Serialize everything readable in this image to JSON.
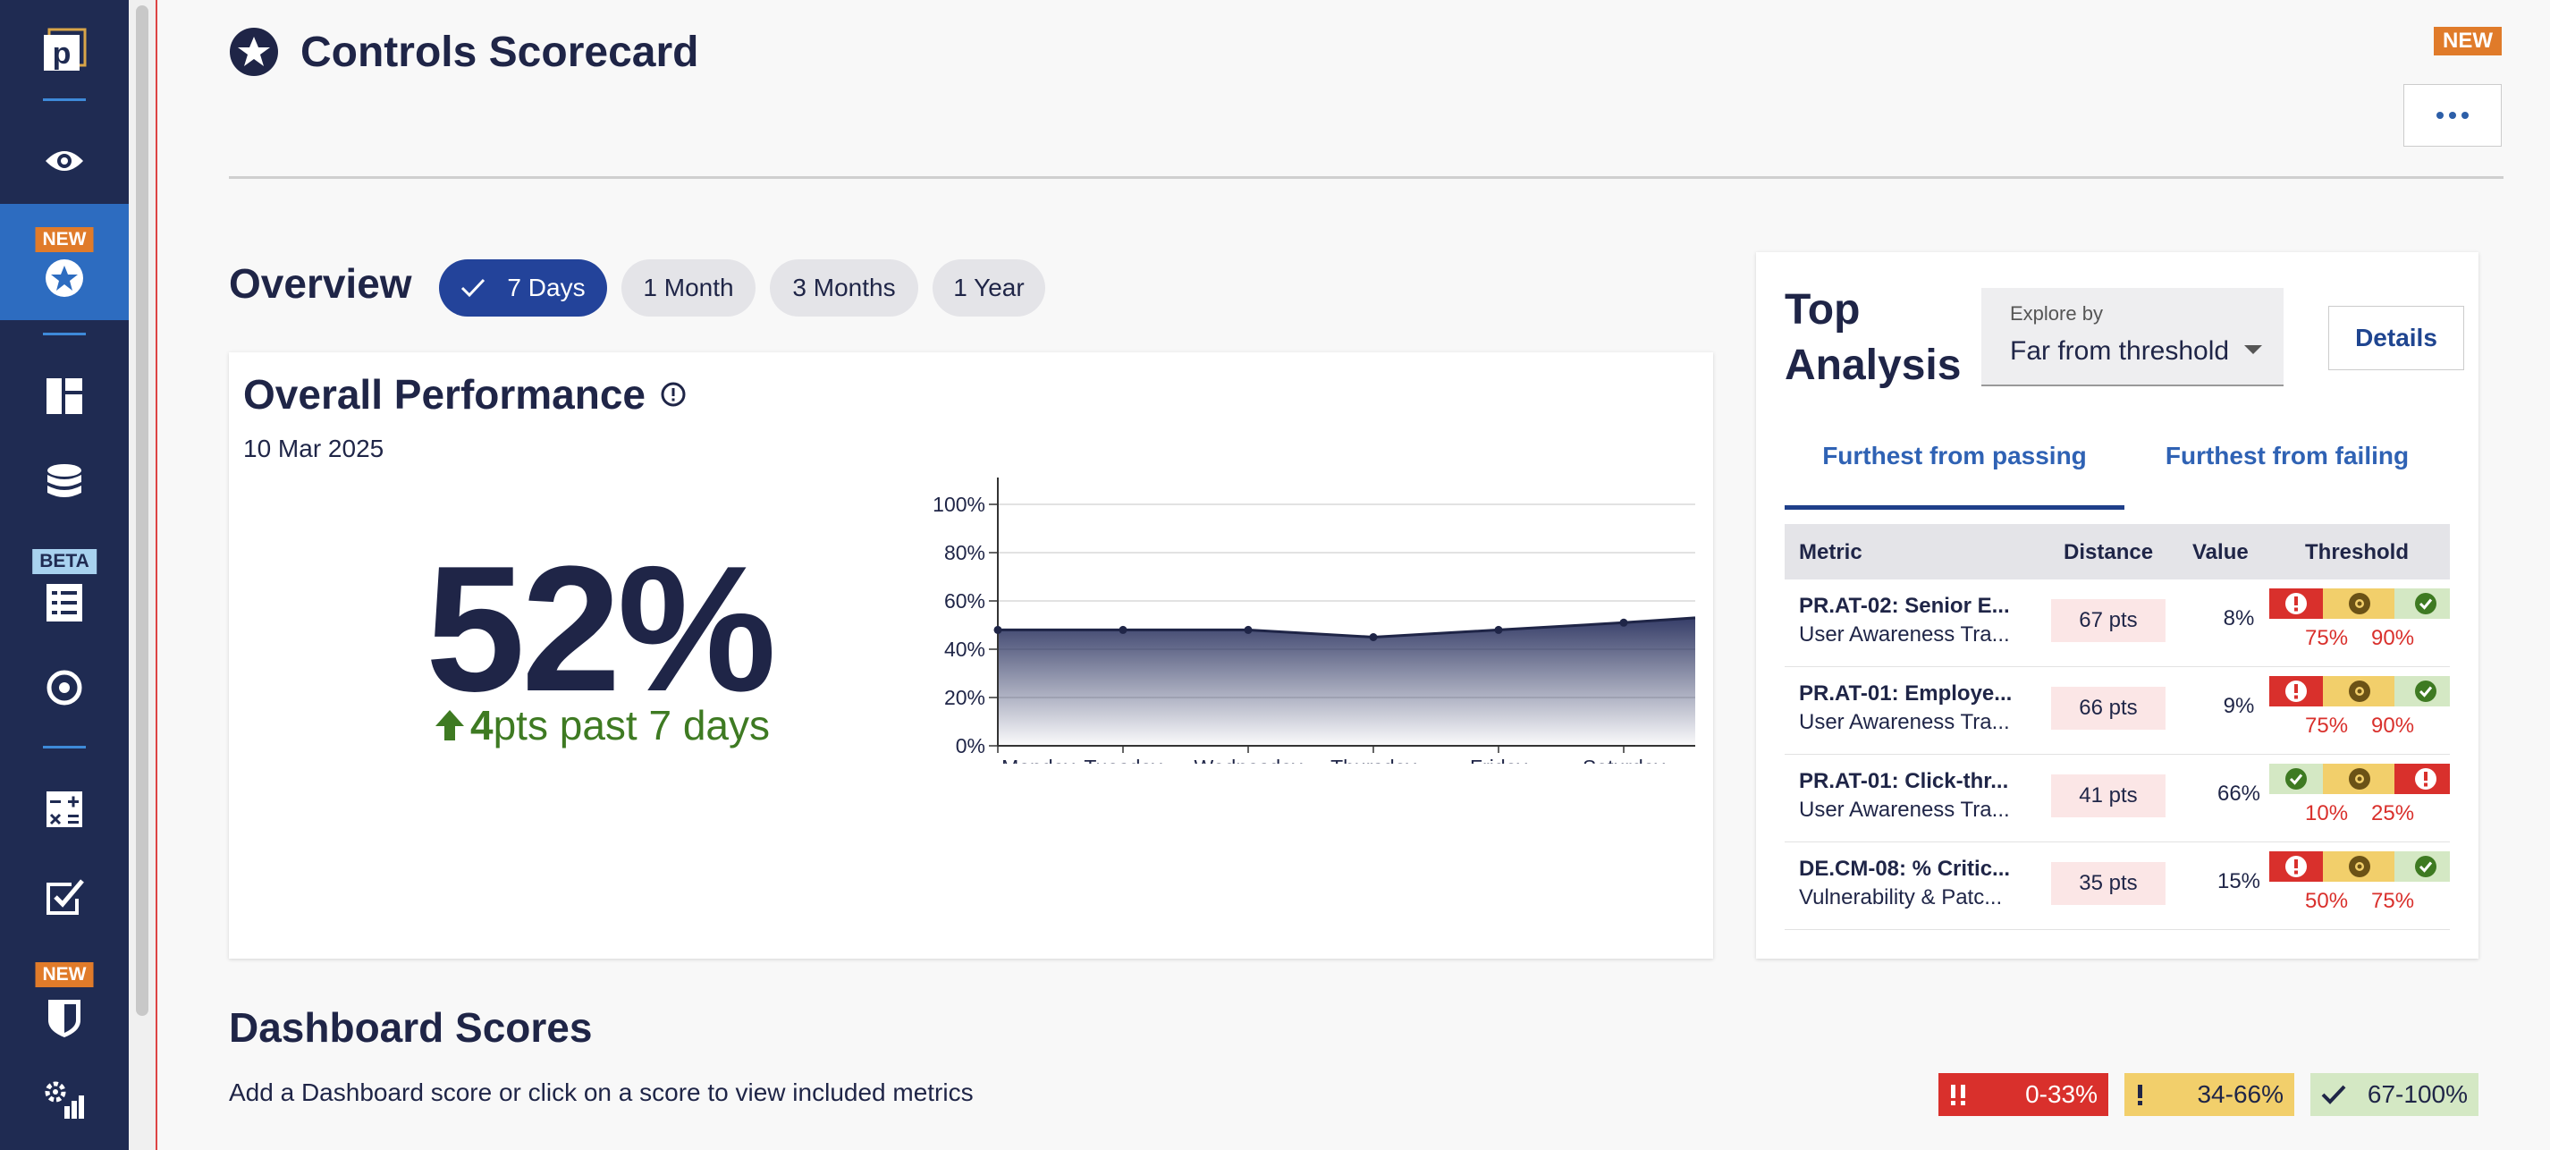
{
  "sidebar": {
    "badges": {
      "new1": "NEW",
      "beta": "BETA",
      "new2": "NEW"
    }
  },
  "header": {
    "title": "Controls Scorecard",
    "new_tag": "NEW"
  },
  "overview": {
    "title": "Overview",
    "periods": [
      {
        "label": "7 Days",
        "selected": true
      },
      {
        "label": "1 Month",
        "selected": false
      },
      {
        "label": "3 Months",
        "selected": false
      },
      {
        "label": "1 Year",
        "selected": false
      }
    ]
  },
  "performance": {
    "title": "Overall Performance",
    "date": "10 Mar 2025",
    "value": "52%",
    "delta_bold": "4",
    "delta_text": "pts past 7 days"
  },
  "chart_data": {
    "type": "area",
    "categories": [
      "Monday",
      "Tuesday",
      "Wednesday",
      "Thursday",
      "Friday",
      "Saturday"
    ],
    "values": [
      48,
      48,
      48,
      45,
      48,
      51,
      53
    ],
    "ylim": [
      0,
      100
    ],
    "yticks": [
      "0%",
      "20%",
      "40%",
      "60%",
      "80%",
      "100%"
    ],
    "grid": true,
    "line_color": "#1f2547"
  },
  "top_analysis": {
    "title_line1": "Top",
    "title_line2": "Analysis",
    "explore_label": "Explore by",
    "explore_value": "Far from threshold",
    "details_label": "Details",
    "tabs": [
      {
        "label": "Furthest from passing",
        "active": true
      },
      {
        "label": "Furthest from failing",
        "active": false
      }
    ],
    "columns": [
      "Metric",
      "Distance",
      "Value",
      "Threshold"
    ],
    "rows": [
      {
        "metric": "PR.AT-02: Senior E...",
        "category": "User Awareness Tra...",
        "distance": "67 pts",
        "value": "8%",
        "direction": "fail-low",
        "t1": "75%",
        "t2": "90%"
      },
      {
        "metric": "PR.AT-01: Employe...",
        "category": "User Awareness Tra...",
        "distance": "66 pts",
        "value": "9%",
        "direction": "fail-low",
        "t1": "75%",
        "t2": "90%"
      },
      {
        "metric": "PR.AT-01: Click-thr...",
        "category": "User Awareness Tra...",
        "distance": "41 pts",
        "value": "66%",
        "direction": "fail-high",
        "t1": "10%",
        "t2": "25%"
      },
      {
        "metric": "DE.CM-08: % Critic...",
        "category": "Vulnerability & Patc...",
        "distance": "35 pts",
        "value": "15%",
        "direction": "fail-low",
        "t1": "50%",
        "t2": "75%"
      }
    ]
  },
  "dashboard_scores": {
    "title": "Dashboard Scores",
    "subtitle": "Add a Dashboard score or click on a score to view included metrics",
    "legend": [
      {
        "range": "0-33%",
        "color": "#d9302c"
      },
      {
        "range": "34-66%",
        "color": "#f2cf6b"
      },
      {
        "range": "67-100%",
        "color": "#d4e8c4"
      }
    ]
  },
  "colors": {
    "navy": "#1f2b52",
    "accent": "#23439a",
    "fail": "#d9302c",
    "warn": "#f2cf6b",
    "pass": "#d4e8c4"
  }
}
